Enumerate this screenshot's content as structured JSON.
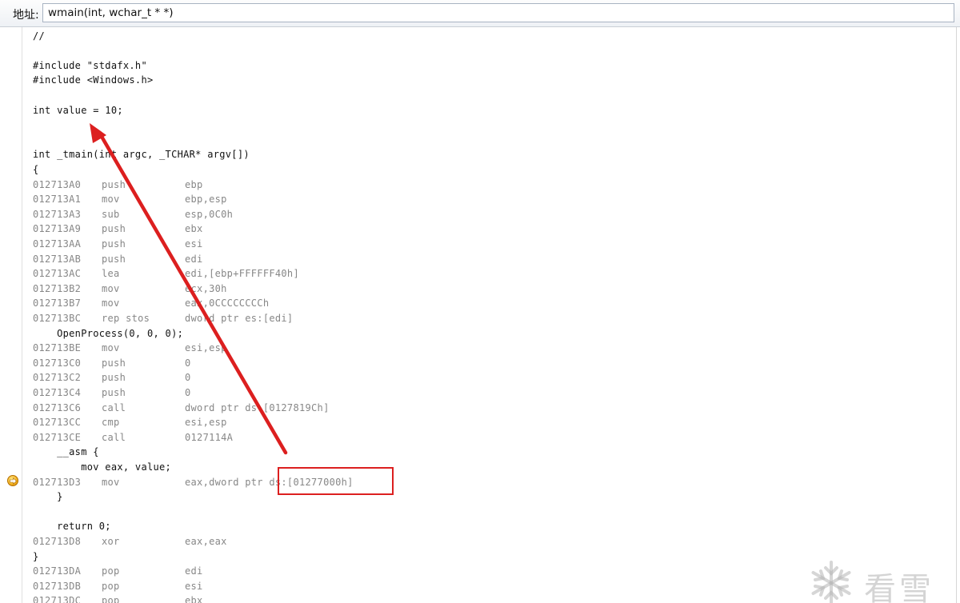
{
  "address_bar": {
    "label": "地址:",
    "value": "wmain(int, wchar_t * *)"
  },
  "code_lines": [
    {
      "kind": "src",
      "text": "//"
    },
    {
      "kind": "blank"
    },
    {
      "kind": "src",
      "text": "#include \"stdafx.h\""
    },
    {
      "kind": "src",
      "text": "#include <Windows.h>"
    },
    {
      "kind": "blank"
    },
    {
      "kind": "src",
      "text": "int value = 10;"
    },
    {
      "kind": "blank"
    },
    {
      "kind": "blank"
    },
    {
      "kind": "src",
      "text": "int _tmain(int argc, _TCHAR* argv[])"
    },
    {
      "kind": "src",
      "text": "{"
    },
    {
      "kind": "asm",
      "addr": "012713A0",
      "mnemonic": "push",
      "operands": "ebp"
    },
    {
      "kind": "asm",
      "addr": "012713A1",
      "mnemonic": "mov",
      "operands": "ebp,esp"
    },
    {
      "kind": "asm",
      "addr": "012713A3",
      "mnemonic": "sub",
      "operands": "esp,0C0h"
    },
    {
      "kind": "asm",
      "addr": "012713A9",
      "mnemonic": "push",
      "operands": "ebx"
    },
    {
      "kind": "asm",
      "addr": "012713AA",
      "mnemonic": "push",
      "operands": "esi"
    },
    {
      "kind": "asm",
      "addr": "012713AB",
      "mnemonic": "push",
      "operands": "edi"
    },
    {
      "kind": "asm",
      "addr": "012713AC",
      "mnemonic": "lea",
      "operands": "edi,[ebp+FFFFFF40h]"
    },
    {
      "kind": "asm",
      "addr": "012713B2",
      "mnemonic": "mov",
      "operands": "ecx,30h"
    },
    {
      "kind": "asm",
      "addr": "012713B7",
      "mnemonic": "mov",
      "operands": "eax,0CCCCCCCCh"
    },
    {
      "kind": "asm",
      "addr": "012713BC",
      "mnemonic": "rep stos",
      "operands": "dword ptr es:[edi]"
    },
    {
      "kind": "src",
      "text": "    OpenProcess(0, 0, 0);"
    },
    {
      "kind": "asm",
      "addr": "012713BE",
      "mnemonic": "mov",
      "operands": "esi,esp"
    },
    {
      "kind": "asm",
      "addr": "012713C0",
      "mnemonic": "push",
      "operands": "0"
    },
    {
      "kind": "asm",
      "addr": "012713C2",
      "mnemonic": "push",
      "operands": "0"
    },
    {
      "kind": "asm",
      "addr": "012713C4",
      "mnemonic": "push",
      "operands": "0"
    },
    {
      "kind": "asm",
      "addr": "012713C6",
      "mnemonic": "call",
      "operands": "dword ptr ds:[0127819Ch]"
    },
    {
      "kind": "asm",
      "addr": "012713CC",
      "mnemonic": "cmp",
      "operands": "esi,esp"
    },
    {
      "kind": "asm",
      "addr": "012713CE",
      "mnemonic": "call",
      "operands": "0127114A"
    },
    {
      "kind": "src",
      "text": "    __asm {"
    },
    {
      "kind": "src",
      "text": "        mov eax, value;"
    },
    {
      "kind": "asm",
      "addr": "012713D3",
      "mnemonic": "mov",
      "operands": "eax,dword ptr ds:[01277000h]",
      "current": true
    },
    {
      "kind": "src",
      "text": "    }"
    },
    {
      "kind": "blank"
    },
    {
      "kind": "src",
      "text": "    return 0;"
    },
    {
      "kind": "asm",
      "addr": "012713D8",
      "mnemonic": "xor",
      "operands": "eax,eax"
    },
    {
      "kind": "src",
      "text": "}"
    },
    {
      "kind": "asm",
      "addr": "012713DA",
      "mnemonic": "pop",
      "operands": "edi"
    },
    {
      "kind": "asm",
      "addr": "012713DB",
      "mnemonic": "pop",
      "operands": "esi"
    },
    {
      "kind": "asm",
      "addr": "012713DC",
      "mnemonic": "pop",
      "operands": "ebx"
    }
  ],
  "colors": {
    "source_text": "#111111",
    "disasm_text": "#878787",
    "annotation": "#dc1f1f"
  },
  "icons": {
    "current_instruction": "yellow-arrow-icon",
    "watermark": "snowflake-icon"
  },
  "watermark": {
    "text": "看雪"
  }
}
